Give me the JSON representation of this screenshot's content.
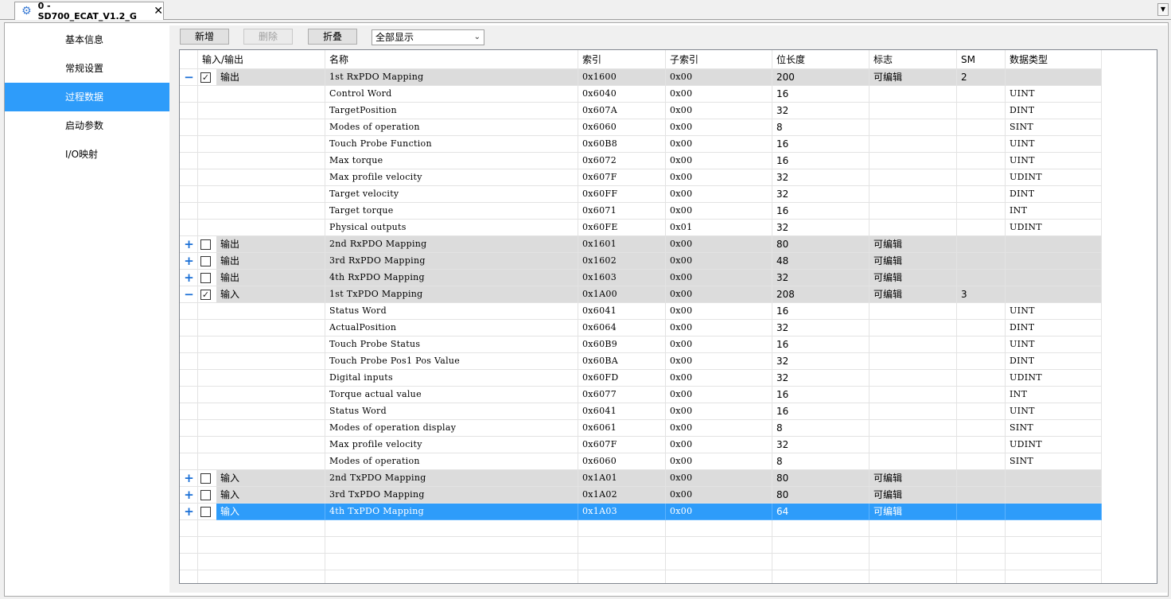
{
  "tab": {
    "title": "0 - SD700_ECAT_V1.2_G",
    "icon": "gear-icon",
    "close": "✕"
  },
  "sidebar": {
    "items": [
      {
        "label": "基本信息",
        "active": false
      },
      {
        "label": "常规设置",
        "active": false
      },
      {
        "label": "过程数据",
        "active": true
      },
      {
        "label": "启动参数",
        "active": false
      },
      {
        "label": "I/O映射",
        "active": false
      }
    ]
  },
  "toolbar": {
    "add_label": "新增",
    "delete_label": "删除",
    "fold_label": "折叠",
    "filter_value": "全部显示"
  },
  "table": {
    "columns": [
      "输入/输出",
      "名称",
      "索引",
      "子索引",
      "位长度",
      "标志",
      "SM",
      "数据类型"
    ],
    "rows": [
      {
        "group": true,
        "expander": "−",
        "checked": true,
        "io": "输出",
        "name": "1st RxPDO Mapping",
        "index": "0x1600",
        "sub": "0x00",
        "bits": "200",
        "flag": "可编辑",
        "sm": "2",
        "type": ""
      },
      {
        "group": false,
        "name": "Control Word",
        "index": "0x6040",
        "sub": "0x00",
        "bits": "16",
        "flag": "",
        "sm": "",
        "type": "UINT"
      },
      {
        "group": false,
        "name": "TargetPosition",
        "index": "0x607A",
        "sub": "0x00",
        "bits": "32",
        "flag": "",
        "sm": "",
        "type": "DINT"
      },
      {
        "group": false,
        "name": "Modes of operation",
        "index": "0x6060",
        "sub": "0x00",
        "bits": "8",
        "flag": "",
        "sm": "",
        "type": "SINT"
      },
      {
        "group": false,
        "name": "Touch Probe Function",
        "index": "0x60B8",
        "sub": "0x00",
        "bits": "16",
        "flag": "",
        "sm": "",
        "type": "UINT"
      },
      {
        "group": false,
        "name": "Max torque",
        "index": "0x6072",
        "sub": "0x00",
        "bits": "16",
        "flag": "",
        "sm": "",
        "type": "UINT"
      },
      {
        "group": false,
        "name": "Max profile velocity",
        "index": "0x607F",
        "sub": "0x00",
        "bits": "32",
        "flag": "",
        "sm": "",
        "type": "UDINT"
      },
      {
        "group": false,
        "name": "Target velocity",
        "index": "0x60FF",
        "sub": "0x00",
        "bits": "32",
        "flag": "",
        "sm": "",
        "type": "DINT"
      },
      {
        "group": false,
        "name": "Target torque",
        "index": "0x6071",
        "sub": "0x00",
        "bits": "16",
        "flag": "",
        "sm": "",
        "type": "INT"
      },
      {
        "group": false,
        "name": "Physical outputs",
        "index": "0x60FE",
        "sub": "0x01",
        "bits": "32",
        "flag": "",
        "sm": "",
        "type": "UDINT"
      },
      {
        "group": true,
        "expander": "+",
        "checked": false,
        "io": "输出",
        "name": "2nd RxPDO Mapping",
        "index": "0x1601",
        "sub": "0x00",
        "bits": "80",
        "flag": "可编辑",
        "sm": "",
        "type": ""
      },
      {
        "group": true,
        "expander": "+",
        "checked": false,
        "io": "输出",
        "name": "3rd RxPDO Mapping",
        "index": "0x1602",
        "sub": "0x00",
        "bits": "48",
        "flag": "可编辑",
        "sm": "",
        "type": ""
      },
      {
        "group": true,
        "expander": "+",
        "checked": false,
        "io": "输出",
        "name": "4th RxPDO Mapping",
        "index": "0x1603",
        "sub": "0x00",
        "bits": "32",
        "flag": "可编辑",
        "sm": "",
        "type": ""
      },
      {
        "group": true,
        "expander": "−",
        "checked": true,
        "io": "输入",
        "name": "1st TxPDO Mapping",
        "index": "0x1A00",
        "sub": "0x00",
        "bits": "208",
        "flag": "可编辑",
        "sm": "3",
        "type": ""
      },
      {
        "group": false,
        "name": "Status Word",
        "index": "0x6041",
        "sub": "0x00",
        "bits": "16",
        "flag": "",
        "sm": "",
        "type": "UINT"
      },
      {
        "group": false,
        "name": "ActualPosition",
        "index": "0x6064",
        "sub": "0x00",
        "bits": "32",
        "flag": "",
        "sm": "",
        "type": "DINT"
      },
      {
        "group": false,
        "name": "Touch Probe Status",
        "index": "0x60B9",
        "sub": "0x00",
        "bits": "16",
        "flag": "",
        "sm": "",
        "type": "UINT"
      },
      {
        "group": false,
        "name": "Touch Probe Pos1 Pos Value",
        "index": "0x60BA",
        "sub": "0x00",
        "bits": "32",
        "flag": "",
        "sm": "",
        "type": "DINT"
      },
      {
        "group": false,
        "name": "Digital inputs",
        "index": "0x60FD",
        "sub": "0x00",
        "bits": "32",
        "flag": "",
        "sm": "",
        "type": "UDINT"
      },
      {
        "group": false,
        "name": "Torque actual value",
        "index": "0x6077",
        "sub": "0x00",
        "bits": "16",
        "flag": "",
        "sm": "",
        "type": "INT"
      },
      {
        "group": false,
        "name": "Status Word",
        "index": "0x6041",
        "sub": "0x00",
        "bits": "16",
        "flag": "",
        "sm": "",
        "type": "UINT"
      },
      {
        "group": false,
        "name": "Modes of operation display",
        "index": "0x6061",
        "sub": "0x00",
        "bits": "8",
        "flag": "",
        "sm": "",
        "type": "SINT"
      },
      {
        "group": false,
        "name": "Max profile velocity",
        "index": "0x607F",
        "sub": "0x00",
        "bits": "32",
        "flag": "",
        "sm": "",
        "type": "UDINT"
      },
      {
        "group": false,
        "name": "Modes of operation",
        "index": "0x6060",
        "sub": "0x00",
        "bits": "8",
        "flag": "",
        "sm": "",
        "type": "SINT"
      },
      {
        "group": true,
        "expander": "+",
        "checked": false,
        "io": "输入",
        "name": "2nd TxPDO Mapping",
        "index": "0x1A01",
        "sub": "0x00",
        "bits": "80",
        "flag": "可编辑",
        "sm": "",
        "type": ""
      },
      {
        "group": true,
        "expander": "+",
        "checked": false,
        "io": "输入",
        "name": "3rd TxPDO Mapping",
        "index": "0x1A02",
        "sub": "0x00",
        "bits": "80",
        "flag": "可编辑",
        "sm": "",
        "type": ""
      },
      {
        "group": true,
        "expander": "+",
        "checked": false,
        "io": "输入",
        "name": "4th TxPDO Mapping",
        "index": "0x1A03",
        "sub": "0x00",
        "bits": "64",
        "flag": "可编辑",
        "sm": "",
        "type": "",
        "selected": true
      }
    ]
  },
  "colors": {
    "accent": "#2e9cfa",
    "group_row": "#dcdcdc",
    "expander": "#1a6fd6"
  }
}
